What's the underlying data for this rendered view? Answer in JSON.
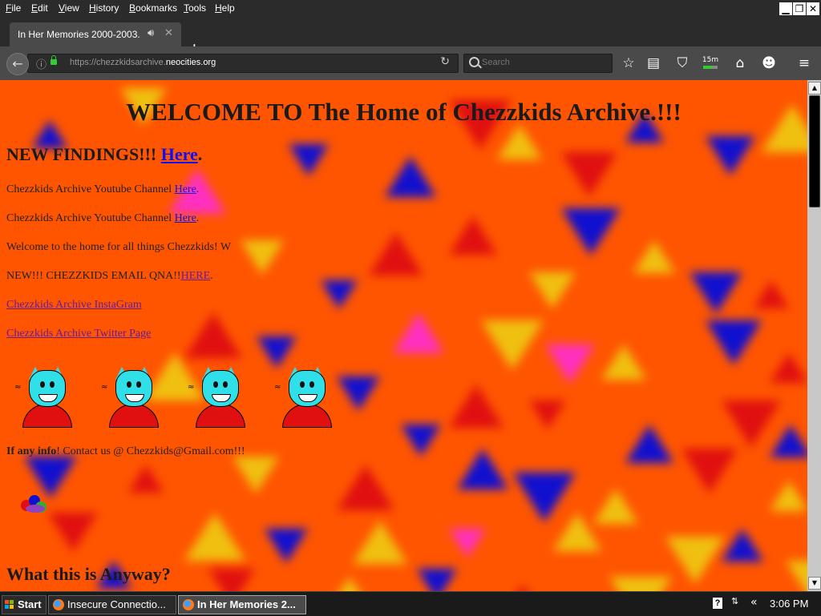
{
  "menu": {
    "items": [
      "File",
      "Edit",
      "View",
      "History",
      "Bookmarks",
      "Tools",
      "Help"
    ]
  },
  "window_controls": {
    "minimize": "▁",
    "restore": "❐",
    "close": "✕"
  },
  "tab": {
    "title": "In Her Memories 2000-2003.",
    "audio_icon": "speaker-icon",
    "close_glyph": "✕",
    "new_tab_glyph": "+"
  },
  "nav": {
    "url_prefix": "https://chezzkidsarchive.",
    "url_domain": "neocities.org",
    "search_placeholder": "Search",
    "timer_label": "15m"
  },
  "page": {
    "heading": "WELCOME TO The Home of Chezzkids Archive.!!!",
    "findings_text": "NEW FINDINGS!!! ",
    "findings_link": "Here",
    "findings_end": ".",
    "yt1_text": "Chezzkids Archive Youtube Channel ",
    "yt1_link": "Here",
    "yt1_end": ".",
    "yt2_text": "Chezzkids Archive Youtube Channel ",
    "yt2_link": "Here",
    "yt2_end": ".",
    "welcome": "Welcome to the home for all things Chezzkids! W",
    "qna_text": "NEW!!! CHEZZKIDS EMAIL QNA!!",
    "qna_link": "HERE",
    "qna_end": ".",
    "instagram_link": "Chezzkids Archive InstaGram",
    "twitter_link": "Chezzkids Archive Twitter Page",
    "contact_bold": "If any info",
    "contact_rest": "! Contact us @ Chezzkids@Gmail.com!!!",
    "subheading": "What this is Anyway?"
  },
  "colors": {
    "page_background": "#ff5500",
    "link": "#1010ee",
    "visited_link": "#6a1a9a",
    "triangle_blue": "#1010d0",
    "triangle_yellow": "#f0c010",
    "triangle_red": "#e01010",
    "triangle_magenta": "#ff30c0"
  },
  "taskbar": {
    "start_label": "Start",
    "task1_label": "Insecure Connectio...",
    "task2_label": "In Her Memories 2...",
    "help_glyph": "?",
    "tray_glyph": "«",
    "clock": "3:06 PM"
  }
}
